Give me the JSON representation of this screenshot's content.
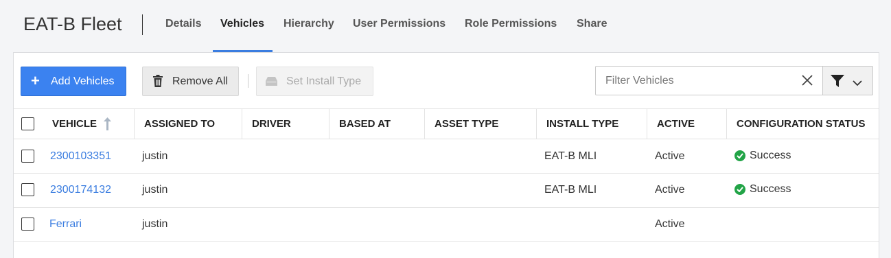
{
  "header": {
    "title": "EAT-B Fleet",
    "tabs": [
      {
        "label": "Details",
        "active": false
      },
      {
        "label": "Vehicles",
        "active": true
      },
      {
        "label": "Hierarchy",
        "active": false
      },
      {
        "label": "User Permissions",
        "active": false
      },
      {
        "label": "Role Permissions",
        "active": false
      },
      {
        "label": "Share",
        "active": false
      }
    ]
  },
  "toolbar": {
    "add_label": "Add Vehicles",
    "remove_label": "Remove All",
    "install_label": "Set Install Type",
    "filter_placeholder": "Filter Vehicles",
    "filter_value": ""
  },
  "icons": {
    "add": "plus-icon",
    "remove": "trash-icon",
    "install": "install-icon",
    "clear": "close-icon",
    "filter": "funnel-icon",
    "dropdown": "chevron-down-icon",
    "sort": "sort-ascending-icon",
    "success": "check-circle-icon"
  },
  "colors": {
    "accent": "#3b7de0",
    "primary_button": "#3b82f0",
    "success": "#22a447"
  },
  "table": {
    "columns": [
      "VEHICLE",
      "ASSIGNED TO",
      "DRIVER",
      "BASED AT",
      "ASSET TYPE",
      "INSTALL TYPE",
      "ACTIVE",
      "CONFIGURATION STATUS"
    ],
    "sort_column": "VEHICLE",
    "sort_direction": "ascending",
    "rows": [
      {
        "vehicle": "2300103351",
        "assigned_to": "justin",
        "driver": "",
        "based_at": "",
        "asset_type": "",
        "install_type": "EAT-B MLI",
        "active": "Active",
        "config_status": "Success"
      },
      {
        "vehicle": "2300174132",
        "assigned_to": "justin",
        "driver": "",
        "based_at": "",
        "asset_type": "",
        "install_type": "EAT-B MLI",
        "active": "Active",
        "config_status": "Success"
      },
      {
        "vehicle": "Ferrari",
        "assigned_to": "justin",
        "driver": "",
        "based_at": "",
        "asset_type": "",
        "install_type": "",
        "active": "Active",
        "config_status": ""
      }
    ]
  }
}
